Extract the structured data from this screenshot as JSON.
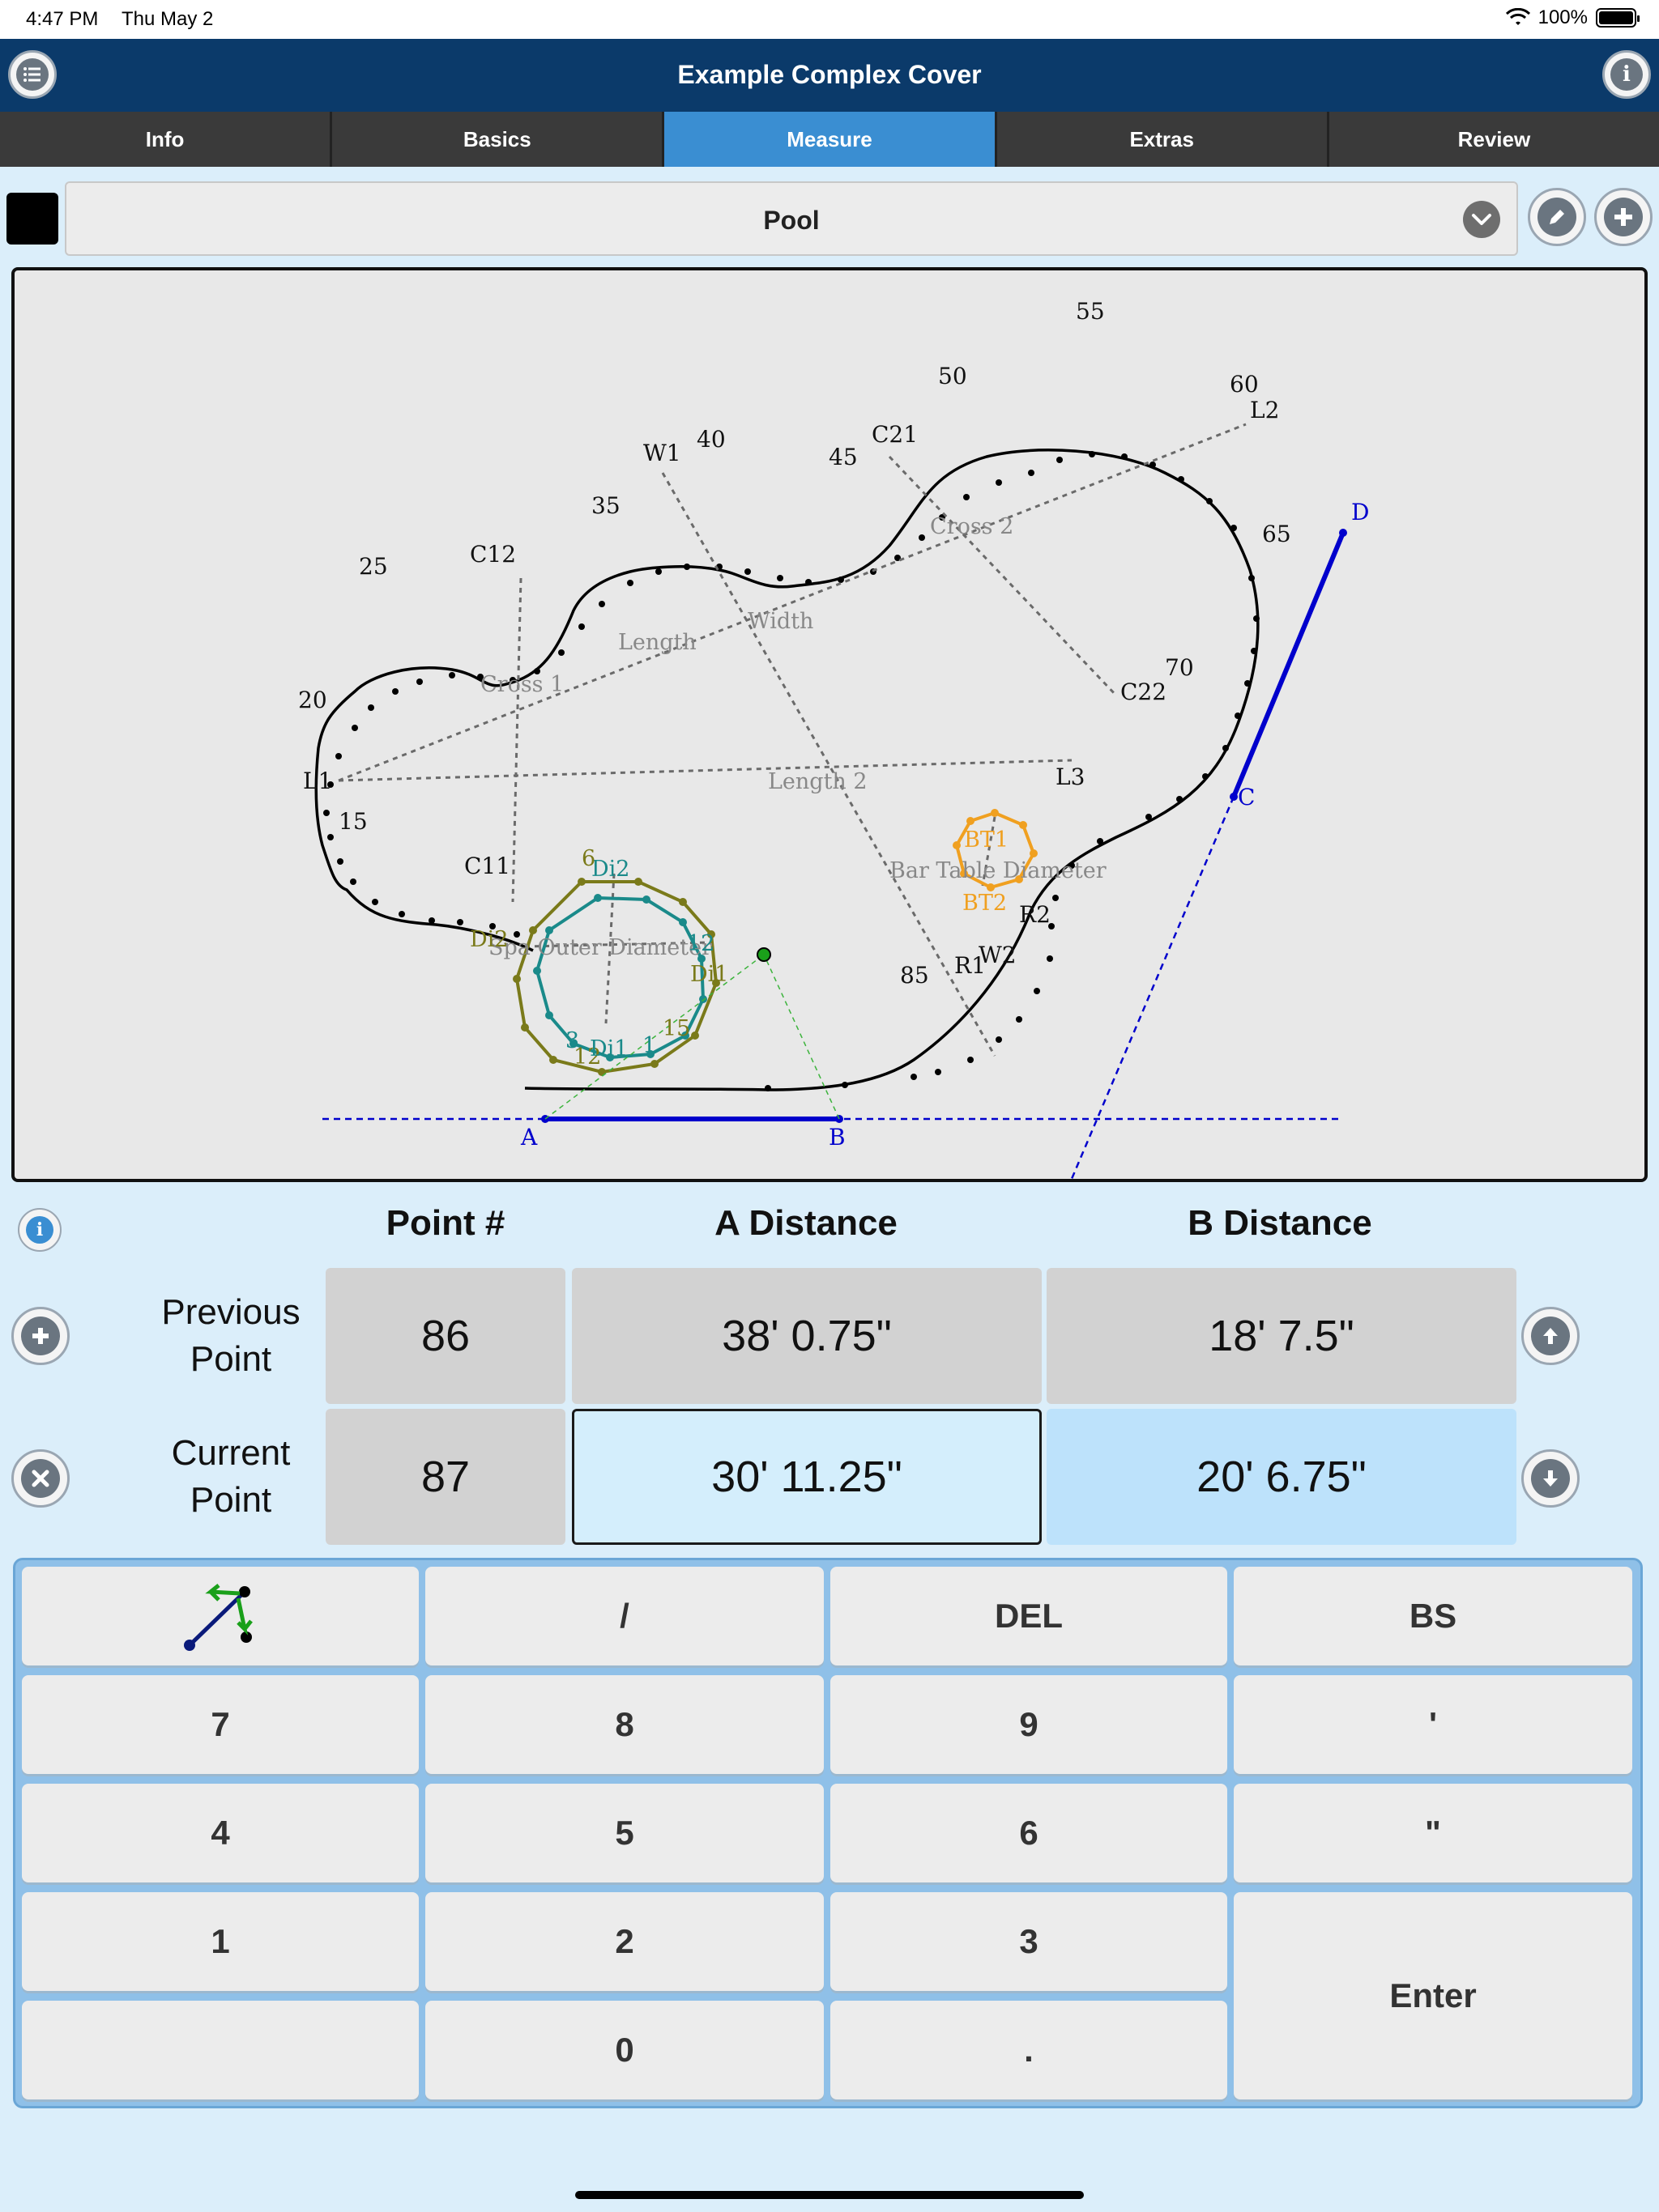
{
  "status": {
    "time": "4:47 PM",
    "date": "Thu May 2",
    "battery": "100%"
  },
  "nav": {
    "title": "Example Complex Cover"
  },
  "tabs": [
    {
      "label": "Info"
    },
    {
      "label": "Basics"
    },
    {
      "label": "Measure",
      "active": true
    },
    {
      "label": "Extras"
    },
    {
      "label": "Review"
    }
  ],
  "layer": {
    "selected": "Pool",
    "swatch_color": "#000000"
  },
  "drawing": {
    "labels": {
      "p55": "55",
      "p50": "50",
      "p60": "60",
      "L2": "L2",
      "C21": "C21",
      "p45": "45",
      "p40": "40",
      "W1": "W1",
      "p35": "35",
      "C12": "C12",
      "p25": "25",
      "p65": "65",
      "cross2": "Cross 2",
      "width": "Width",
      "length": "Length",
      "cross1": "Cross 1",
      "p20": "20",
      "p70": "70",
      "C22": "C22",
      "L1": "L1",
      "length2": "Length 2",
      "L3": "L3",
      "p15": "15",
      "C11": "C11",
      "Di2": "Di2",
      "p6": "6",
      "BT1": "BT1",
      "bar_table": "Bar Table Diameter",
      "BT2": "BT2",
      "R2": "R2",
      "Di2b": "Di2",
      "spa": "Spa Outer Diameter",
      "p12a": "12",
      "W2": "W2",
      "R1": "R1",
      "p85": "85",
      "Di1": "Di1",
      "p3": "3",
      "p15b": "15",
      "p12b": "12",
      "Di1b": "Di1",
      "p1": "1",
      "A": "A",
      "B": "B",
      "C": "C",
      "D": "D"
    }
  },
  "measure": {
    "headers": {
      "point": "Point #",
      "a": "A Distance",
      "b": "B Distance"
    },
    "previous": {
      "label": "Previous Point",
      "point": "86",
      "a": "38' 0.75\"",
      "b": "18' 7.5\""
    },
    "current": {
      "label": "Current Point",
      "point": "87",
      "a": "30' 11.25\"",
      "b": "20' 6.75\""
    }
  },
  "keypad": {
    "slash": "/",
    "del": "DEL",
    "bs": "BS",
    "k7": "7",
    "k8": "8",
    "k9": "9",
    "ft": "'",
    "k4": "4",
    "k5": "5",
    "k6": "6",
    "in": "\"",
    "k1": "1",
    "k2": "2",
    "k3": "3",
    "enter": "Enter",
    "k0": "0",
    "dot": "."
  },
  "colors": {
    "accent": "#3a8ed2",
    "navbar": "#0b3a6a",
    "outline": "#000000",
    "spa_outer": "#7a7a1a",
    "spa_inner": "#1a8a8a",
    "bar_table": "#f0a020",
    "baseline": "#0000cc"
  }
}
